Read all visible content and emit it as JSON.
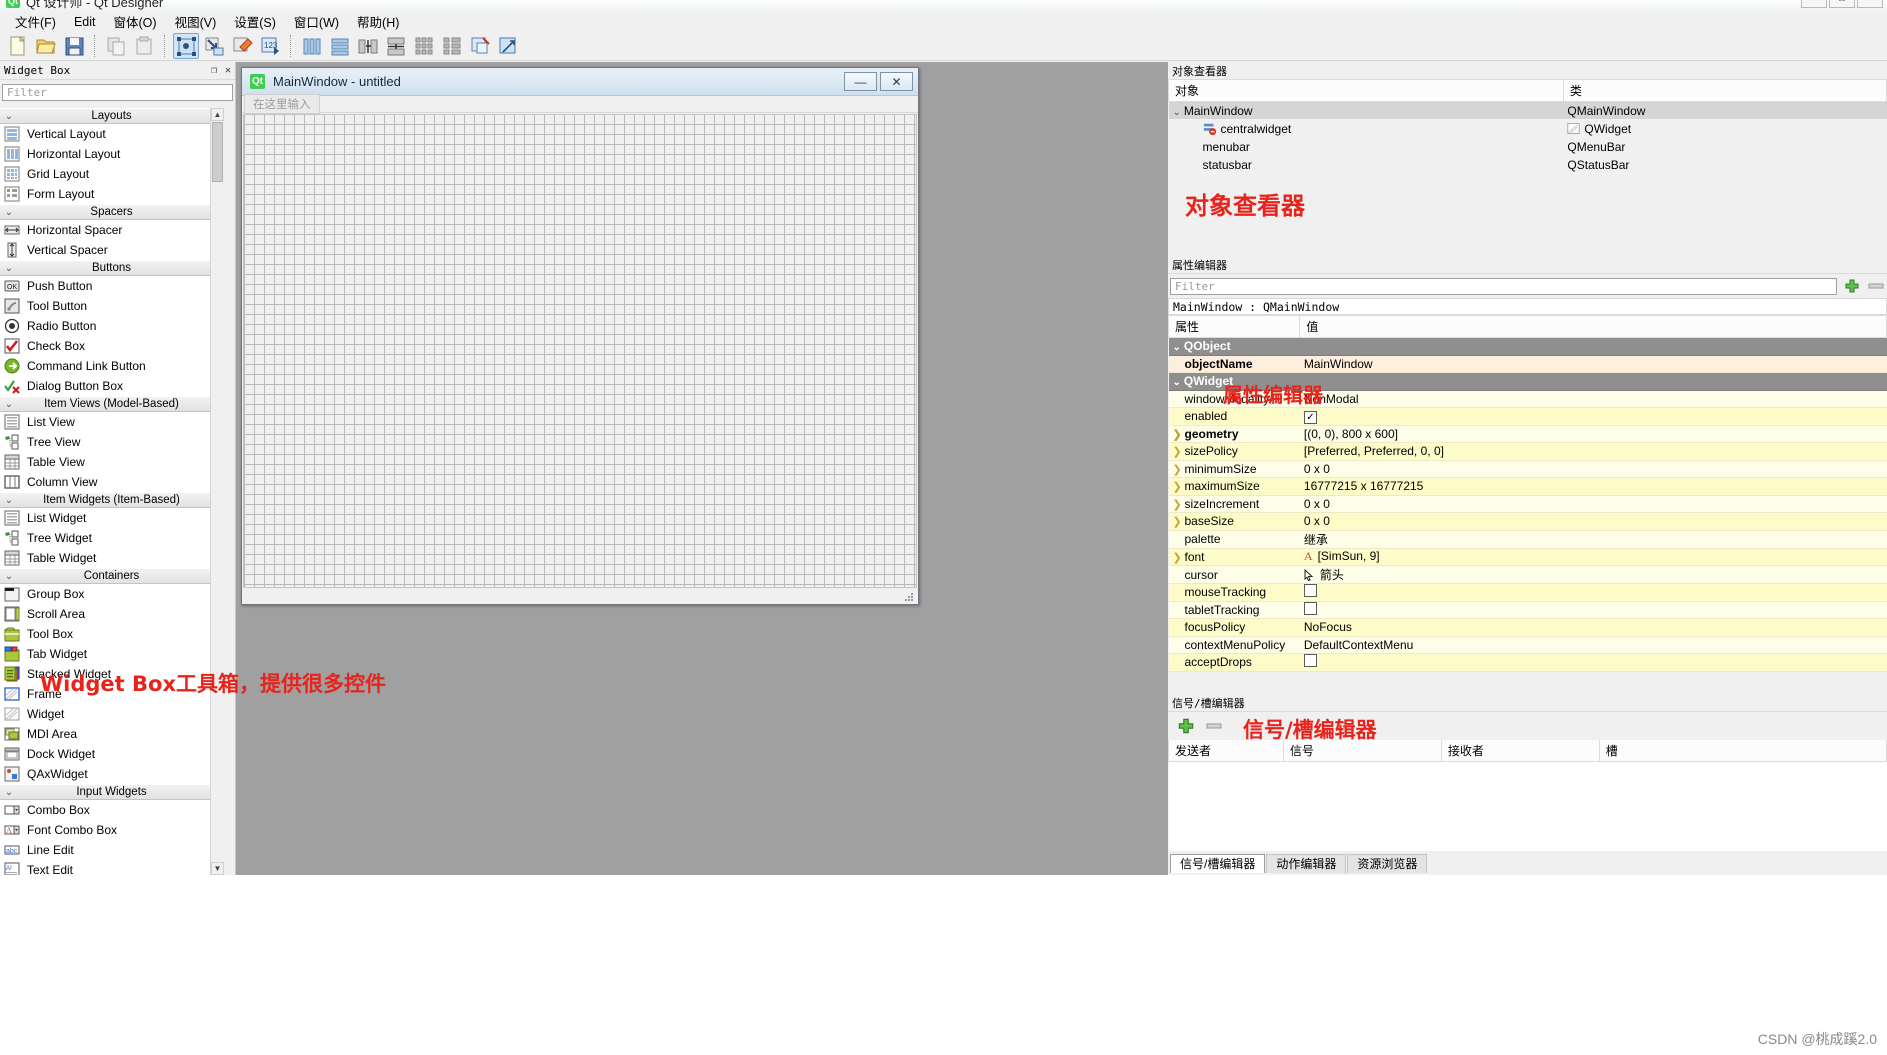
{
  "window": {
    "title": "Qt 设计师 - Qt Designer",
    "logo": "Qt",
    "minimize": "—",
    "maximize": "□",
    "close": "✕"
  },
  "menubar": {
    "items": [
      {
        "label": "文件(F)"
      },
      {
        "label": "Edit"
      },
      {
        "label": "窗体(O)"
      },
      {
        "label": "视图(V)"
      },
      {
        "label": "设置(S)"
      },
      {
        "label": "窗口(W)"
      },
      {
        "label": "帮助(H)"
      }
    ]
  },
  "toolbar": {
    "groups": [
      {
        "icons": [
          "new-file-icon",
          "open-folder-icon",
          "save-icon"
        ]
      },
      {
        "icons": [
          "copy-icon",
          "paste-icon"
        ]
      },
      {
        "icons": [
          "edit-widgets-icon",
          "edit-signals-slots-icon",
          "edit-buddies-icon",
          "edit-tab-order-icon"
        ]
      },
      {
        "icons": [
          "layout-horizontal-icon",
          "layout-vertical-icon",
          "layout-splitter-h-icon",
          "layout-splitter-v-icon",
          "layout-grid-icon",
          "layout-form-icon",
          "break-layout-icon",
          "adjust-size-icon"
        ]
      }
    ],
    "active_icon": "edit-widgets-icon"
  },
  "widget_box": {
    "title": "Widget Box",
    "float_button": "❐",
    "close_button": "✕",
    "filter_placeholder": "Filter",
    "categories": [
      {
        "name": "Layouts",
        "items": [
          {
            "label": "Vertical Layout",
            "icon": "vertical-layout-icon"
          },
          {
            "label": "Horizontal Layout",
            "icon": "horizontal-layout-icon"
          },
          {
            "label": "Grid Layout",
            "icon": "grid-layout-icon"
          },
          {
            "label": "Form Layout",
            "icon": "form-layout-icon"
          }
        ]
      },
      {
        "name": "Spacers",
        "items": [
          {
            "label": "Horizontal Spacer",
            "icon": "horizontal-spacer-icon"
          },
          {
            "label": "Vertical Spacer",
            "icon": "vertical-spacer-icon"
          }
        ]
      },
      {
        "name": "Buttons",
        "items": [
          {
            "label": "Push Button",
            "icon": "push-button-icon"
          },
          {
            "label": "Tool Button",
            "icon": "tool-button-icon"
          },
          {
            "label": "Radio Button",
            "icon": "radio-button-icon"
          },
          {
            "label": "Check Box",
            "icon": "check-box-icon"
          },
          {
            "label": "Command Link Button",
            "icon": "command-link-button-icon"
          },
          {
            "label": "Dialog Button Box",
            "icon": "dialog-button-box-icon"
          }
        ]
      },
      {
        "name": "Item Views (Model-Based)",
        "items": [
          {
            "label": "List View",
            "icon": "list-view-icon"
          },
          {
            "label": "Tree View",
            "icon": "tree-view-icon"
          },
          {
            "label": "Table View",
            "icon": "table-view-icon"
          },
          {
            "label": "Column View",
            "icon": "column-view-icon"
          }
        ]
      },
      {
        "name": "Item Widgets (Item-Based)",
        "items": [
          {
            "label": "List Widget",
            "icon": "list-widget-icon"
          },
          {
            "label": "Tree Widget",
            "icon": "tree-widget-icon"
          },
          {
            "label": "Table Widget",
            "icon": "table-widget-icon"
          }
        ]
      },
      {
        "name": "Containers",
        "items": [
          {
            "label": "Group Box",
            "icon": "group-box-icon"
          },
          {
            "label": "Scroll Area",
            "icon": "scroll-area-icon"
          },
          {
            "label": "Tool Box",
            "icon": "tool-box-icon"
          },
          {
            "label": "Tab Widget",
            "icon": "tab-widget-icon"
          },
          {
            "label": "Stacked Widget",
            "icon": "stacked-widget-icon"
          },
          {
            "label": "Frame",
            "icon": "frame-icon"
          },
          {
            "label": "Widget",
            "icon": "widget-icon"
          },
          {
            "label": "MDI Area",
            "icon": "mdi-area-icon"
          },
          {
            "label": "Dock Widget",
            "icon": "dock-widget-icon"
          },
          {
            "label": "QAxWidget",
            "icon": "qax-widget-icon"
          }
        ]
      },
      {
        "name": "Input Widgets",
        "items": [
          {
            "label": "Combo Box",
            "icon": "combo-box-icon"
          },
          {
            "label": "Font Combo Box",
            "icon": "font-combo-box-icon"
          },
          {
            "label": "Line Edit",
            "icon": "line-edit-icon"
          },
          {
            "label": "Text Edit",
            "icon": "text-edit-icon"
          }
        ]
      }
    ]
  },
  "form_window": {
    "title": "MainWindow - untitled",
    "logo": "Qt",
    "minimize": "—",
    "close": "✕",
    "menu_placeholder": "在这里输入"
  },
  "object_inspector": {
    "title": "对象查看器",
    "columns": [
      "对象",
      "类"
    ],
    "rows": [
      {
        "name": "MainWindow",
        "class": "QMainWindow",
        "indent": 0,
        "expandable": true,
        "selected": true,
        "icon": ""
      },
      {
        "name": "centralwidget",
        "class": "QWidget",
        "indent": 1,
        "expandable": false,
        "selected": false,
        "icon": "central-widget-icon"
      },
      {
        "name": "menubar",
        "class": "QMenuBar",
        "indent": 1,
        "expandable": false,
        "selected": false,
        "icon": ""
      },
      {
        "name": "statusbar",
        "class": "QStatusBar",
        "indent": 1,
        "expandable": false,
        "selected": false,
        "icon": ""
      }
    ]
  },
  "property_editor": {
    "title": "属性编辑器",
    "filter_placeholder": "Filter",
    "add_button": "+",
    "remove_button": "—",
    "object_line": "MainWindow : QMainWindow",
    "columns": [
      "属性",
      "值"
    ],
    "rows": [
      {
        "kind": "group",
        "name": "QObject"
      },
      {
        "kind": "prop",
        "name": "objectName",
        "value": "MainWindow",
        "bold": true,
        "expandable": false,
        "style": "cream"
      },
      {
        "kind": "group",
        "name": "QWidget"
      },
      {
        "kind": "prop",
        "name": "windowModality",
        "value": "NonModal",
        "bold": false,
        "expandable": false,
        "style": "lyellow"
      },
      {
        "kind": "prop",
        "name": "enabled",
        "value": "☑",
        "bold": false,
        "expandable": false,
        "style": "yellow",
        "is_checkbox": true,
        "checked": true
      },
      {
        "kind": "prop",
        "name": "geometry",
        "value": "[(0, 0), 800 x 600]",
        "bold": true,
        "expandable": true,
        "style": "lyellow"
      },
      {
        "kind": "prop",
        "name": "sizePolicy",
        "value": "[Preferred, Preferred, 0, 0]",
        "bold": false,
        "expandable": true,
        "style": "yellow"
      },
      {
        "kind": "prop",
        "name": "minimumSize",
        "value": "0 x 0",
        "bold": false,
        "expandable": true,
        "style": "lyellow"
      },
      {
        "kind": "prop",
        "name": "maximumSize",
        "value": "16777215 x 16777215",
        "bold": false,
        "expandable": true,
        "style": "yellow"
      },
      {
        "kind": "prop",
        "name": "sizeIncrement",
        "value": "0 x 0",
        "bold": false,
        "expandable": true,
        "style": "lyellow"
      },
      {
        "kind": "prop",
        "name": "baseSize",
        "value": "0 x 0",
        "bold": false,
        "expandable": true,
        "style": "yellow"
      },
      {
        "kind": "prop",
        "name": "palette",
        "value": "继承",
        "bold": false,
        "expandable": false,
        "style": "lyellow"
      },
      {
        "kind": "prop",
        "name": "font",
        "value": "[SimSun, 9]",
        "bold": false,
        "expandable": true,
        "style": "yellow",
        "icon": "font-icon"
      },
      {
        "kind": "prop",
        "name": "cursor",
        "value": "箭头",
        "bold": false,
        "expandable": false,
        "style": "lyellow",
        "icon": "cursor-arrow-icon"
      },
      {
        "kind": "prop",
        "name": "mouseTracking",
        "value": "☐",
        "bold": false,
        "expandable": false,
        "style": "yellow",
        "is_checkbox": true,
        "checked": false
      },
      {
        "kind": "prop",
        "name": "tabletTracking",
        "value": "☐",
        "bold": false,
        "expandable": false,
        "style": "lyellow",
        "is_checkbox": true,
        "checked": false
      },
      {
        "kind": "prop",
        "name": "focusPolicy",
        "value": "NoFocus",
        "bold": false,
        "expandable": false,
        "style": "yellow"
      },
      {
        "kind": "prop",
        "name": "contextMenuPolicy",
        "value": "DefaultContextMenu",
        "bold": false,
        "expandable": false,
        "style": "lyellow"
      },
      {
        "kind": "prop",
        "name": "acceptDrops",
        "value": "☐",
        "bold": false,
        "expandable": false,
        "style": "yellow",
        "is_checkbox": true,
        "checked": false
      }
    ]
  },
  "signal_slot_editor": {
    "title": "信号/槽编辑器",
    "add_button": "+",
    "remove_button": "—",
    "columns": [
      "发送者",
      "信号",
      "接收者",
      "槽"
    ]
  },
  "bottom_tabs": {
    "items": [
      {
        "label": "信号/槽编辑器",
        "selected": true
      },
      {
        "label": "动作编辑器",
        "selected": false
      },
      {
        "label": "资源浏览器",
        "selected": false
      }
    ]
  },
  "annotations": {
    "widget_box": "Widget Box工具箱，提供很多控件",
    "object_inspector": "对象查看器",
    "property_editor": "属性编辑器",
    "signal_slot_editor": "信号/槽编辑器"
  },
  "watermark": "CSDN @桃成蹊2.0",
  "colors": {
    "annotation_red": "#e8231c",
    "qt_green": "#41cd52",
    "group_header": "#8f8f8f",
    "prop_cream": "#fdeedd",
    "prop_yellow": "#fdfbc8"
  }
}
